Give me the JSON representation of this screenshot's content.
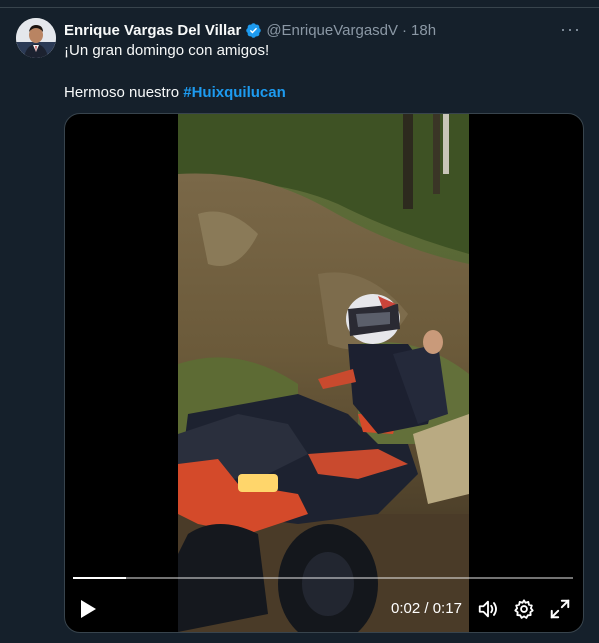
{
  "tweet": {
    "author_name": "Enrique Vargas Del Villar",
    "handle": "@EnriqueVargasdV",
    "separator": "·",
    "time": "18h",
    "more": "···",
    "line1": "¡Un gran domingo con amigos!",
    "line2_prefix": "Hermoso nuestro",
    "hashtag": "#Huixquilucan"
  },
  "video": {
    "current_time": "0:02",
    "duration": "0:17",
    "timecode_separator": "/",
    "progress": 0.105
  },
  "colors": {
    "background": "#15202b",
    "accent": "#1d9bf0",
    "secondary_text": "#8b98a5",
    "border": "#38444d"
  }
}
